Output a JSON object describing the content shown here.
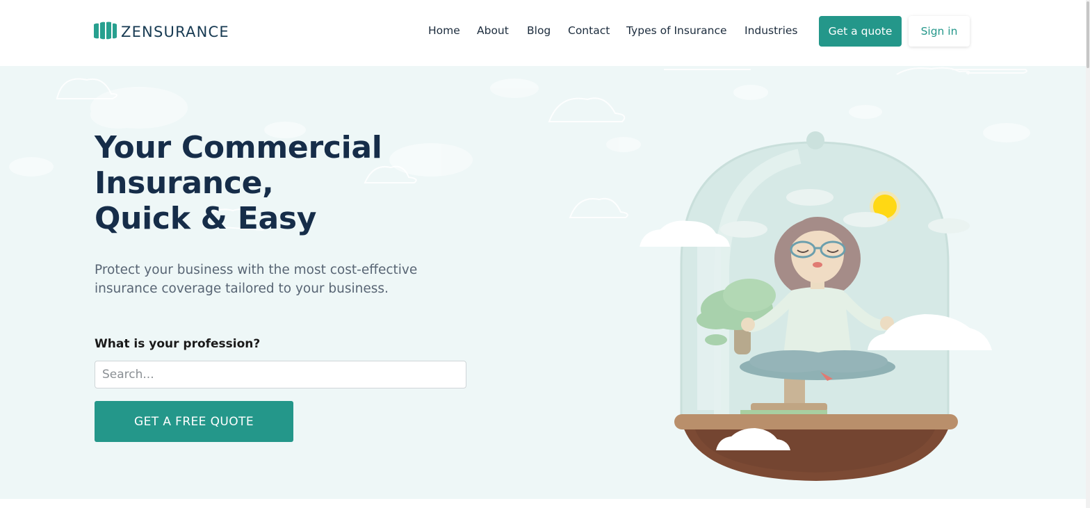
{
  "brand": {
    "name": "ZENSURANCE",
    "color": "#173a52",
    "icon": "logo-mark-icon"
  },
  "nav": {
    "items": [
      {
        "label": "Home"
      },
      {
        "label": "About"
      },
      {
        "label": "Blog"
      },
      {
        "label": "Contact"
      },
      {
        "label": "Types of Insurance"
      },
      {
        "label": "Industries"
      }
    ],
    "quote_button": "Get a quote",
    "signin_button": "Sign in"
  },
  "hero": {
    "title_lines": [
      "Your Commercial",
      "Insurance,",
      "Quick & Easy"
    ],
    "subtitle": "Protect your business with the most cost-effective insurance coverage tailored to your business.",
    "profession_label": "What is your profession?",
    "search_placeholder": "Search...",
    "cta_button": "GET A FREE QUOTE",
    "illustration": "meditating-woman-under-glass-dome-icon"
  },
  "colors": {
    "accent": "#24978a",
    "heading": "#162d49",
    "hero_background": "#eef7f7"
  }
}
